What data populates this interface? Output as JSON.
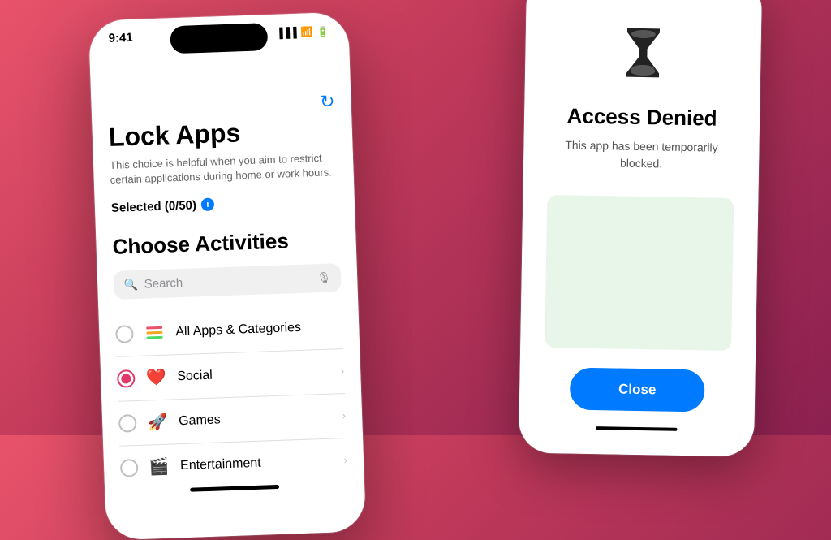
{
  "background": {
    "gradient_start": "#e8536a",
    "gradient_end": "#8b2050"
  },
  "phone_left": {
    "status_bar": {
      "time": "9:41",
      "signal_icon": "signal-icon",
      "wifi_icon": "wifi-icon",
      "battery_icon": "battery-icon"
    },
    "title": "Lock Apps",
    "description": "This choice is helpful when you aim to restrict certain applications during home or work hours.",
    "selected_label": "Selected (0/50)",
    "info_icon_label": "i",
    "section_title": "Choose Activities",
    "search_placeholder": "Search",
    "activities": [
      {
        "name": "All Apps & Categories",
        "icon": "📚",
        "selected": false,
        "has_chevron": false
      },
      {
        "name": "Social",
        "icon": "❤️",
        "selected": true,
        "has_chevron": true
      },
      {
        "name": "Games",
        "icon": "🚀",
        "selected": false,
        "has_chevron": true
      },
      {
        "name": "Entertainment",
        "icon": "🎬",
        "selected": false,
        "has_chevron": true
      }
    ]
  },
  "phone_right": {
    "hourglass": "⏳",
    "title": "Access Denied",
    "description": "This app has been temporarily blocked.",
    "close_button_label": "Close"
  }
}
